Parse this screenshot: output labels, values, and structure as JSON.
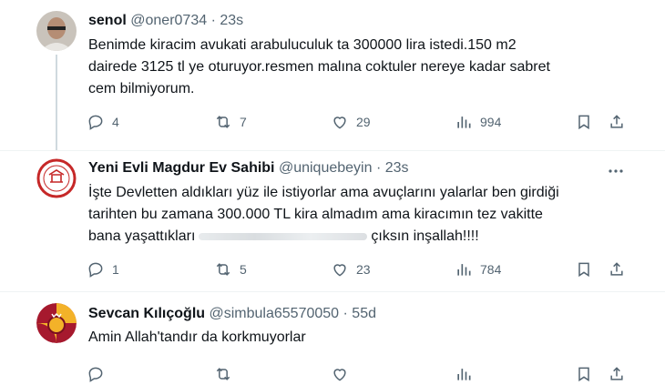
{
  "tweets": [
    {
      "name": "senol",
      "handle": "@oner0734",
      "dot": "·",
      "time": "23s",
      "text_lines": [
        "Benimde kiracim  avukati arabuluculuk ta 300000 lira istedi.150 m2",
        "dairede 3125 tl ye oturuyor.resmen malına coktuler nereye kadar sabret",
        "cem bilmiyorum."
      ],
      "replies": "4",
      "retweets": "7",
      "likes": "29",
      "views": "994"
    },
    {
      "name": "Yeni Evli Magdur Ev Sahibi",
      "handle": "@uniquebeyin",
      "dot": "·",
      "time": "23s",
      "text_lines": [
        "İşte Devletten aldıkları yüz ile istiyorlar ama avuçlarını yalarlar ben girdiği",
        "tarihten bu zamana 300.000 TL kira almadım ama kiracımın tez vakitte"
      ],
      "line3_before": "bana yaşattıkları",
      "line3_after": "çıksın inşallah!!!!",
      "replies": "1",
      "retweets": "5",
      "likes": "23",
      "views": "784"
    },
    {
      "name": "Sevcan Kılıçoğlu",
      "handle": "@simbula65570050",
      "dot": "·",
      "time": "55d",
      "text_lines": [
        "Amin  Allah'tandır da korkmuyorlar"
      ]
    }
  ],
  "colors": {
    "text": "#0f1419",
    "secondary": "#536471",
    "divider": "#eff3f4",
    "thread": "#cfd9de"
  },
  "icons": [
    "reply-icon",
    "retweet-icon",
    "like-icon",
    "views-icon",
    "bookmark-icon",
    "share-icon",
    "more-icon"
  ]
}
